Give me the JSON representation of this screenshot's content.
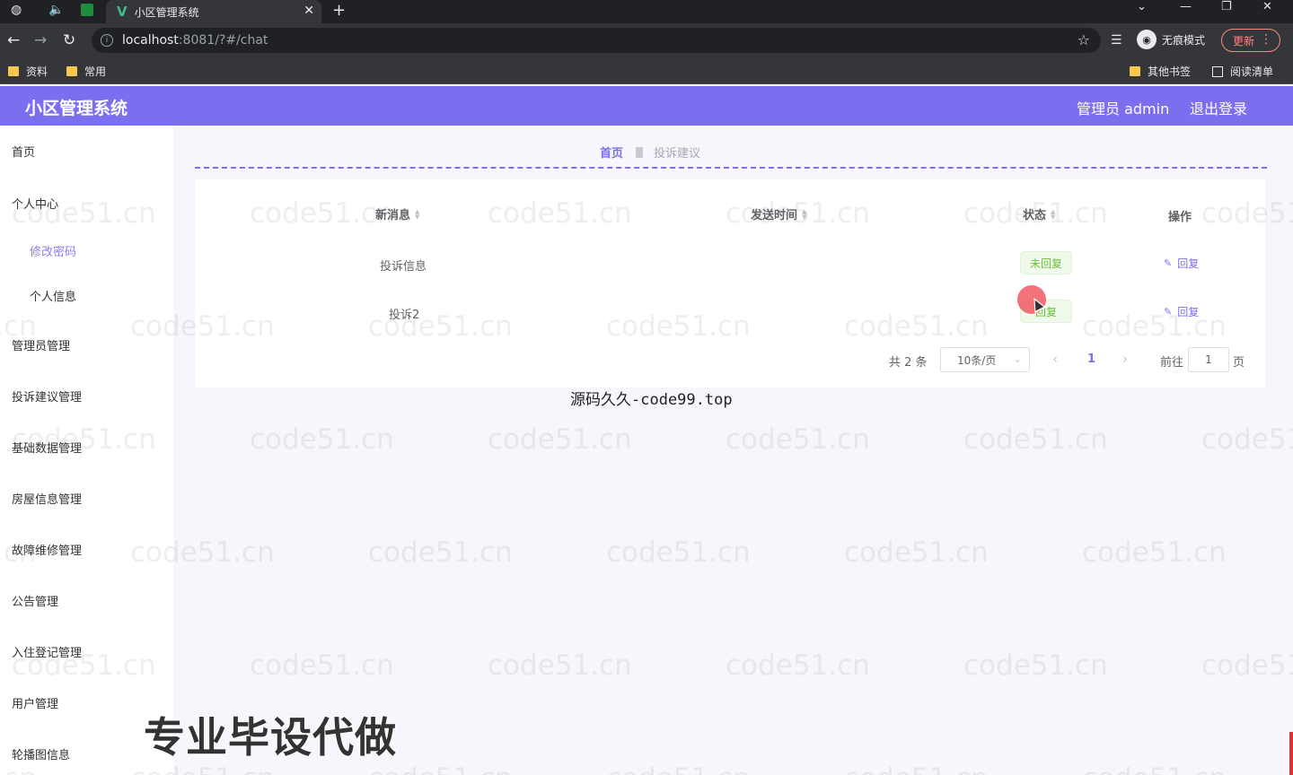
{
  "browser": {
    "tab_title": "小区管理系统",
    "url_host": "localhost",
    "url_path": ":8081/?#/chat",
    "incognito_label": "无痕模式",
    "update_label": "更新",
    "bookmarks": [
      "资料",
      "常用"
    ],
    "bookmarks_right": [
      "其他书签",
      "阅读清单"
    ]
  },
  "header": {
    "title": "小区管理系统",
    "user": "管理员 admin",
    "logout": "退出登录",
    "color": "#7b6ff0"
  },
  "sidebar": {
    "items": [
      {
        "label": "首页"
      },
      {
        "label": "个人中心"
      },
      {
        "label": "修改密码"
      },
      {
        "label": "个人信息"
      },
      {
        "label": "管理员管理"
      },
      {
        "label": "投诉建议管理"
      },
      {
        "label": "基础数据管理"
      },
      {
        "label": "房屋信息管理"
      },
      {
        "label": "故障维修管理"
      },
      {
        "label": "公告管理"
      },
      {
        "label": "入住登记管理"
      },
      {
        "label": "用户管理"
      },
      {
        "label": "轮播图信息"
      }
    ]
  },
  "breadcrumb": {
    "home": "首页",
    "current": "投诉建议"
  },
  "table": {
    "headers": [
      "新消息",
      "发送时间",
      "状态",
      "操作"
    ],
    "rows": [
      {
        "message": "投诉信息",
        "time": "",
        "status": "未回复",
        "action": "回复"
      },
      {
        "message": "投诉2",
        "time": "",
        "status": "回复",
        "action": "回复"
      }
    ]
  },
  "pagination": {
    "total": "共 2 条",
    "page_size": "10条/页",
    "current_page": "1",
    "goto_label": "前往",
    "goto_value": "1",
    "page_suffix": "页"
  },
  "overlays": {
    "source_text": "源码久久-code99.top",
    "ad_text": "专业毕设代做",
    "watermark": "code51.cn"
  }
}
